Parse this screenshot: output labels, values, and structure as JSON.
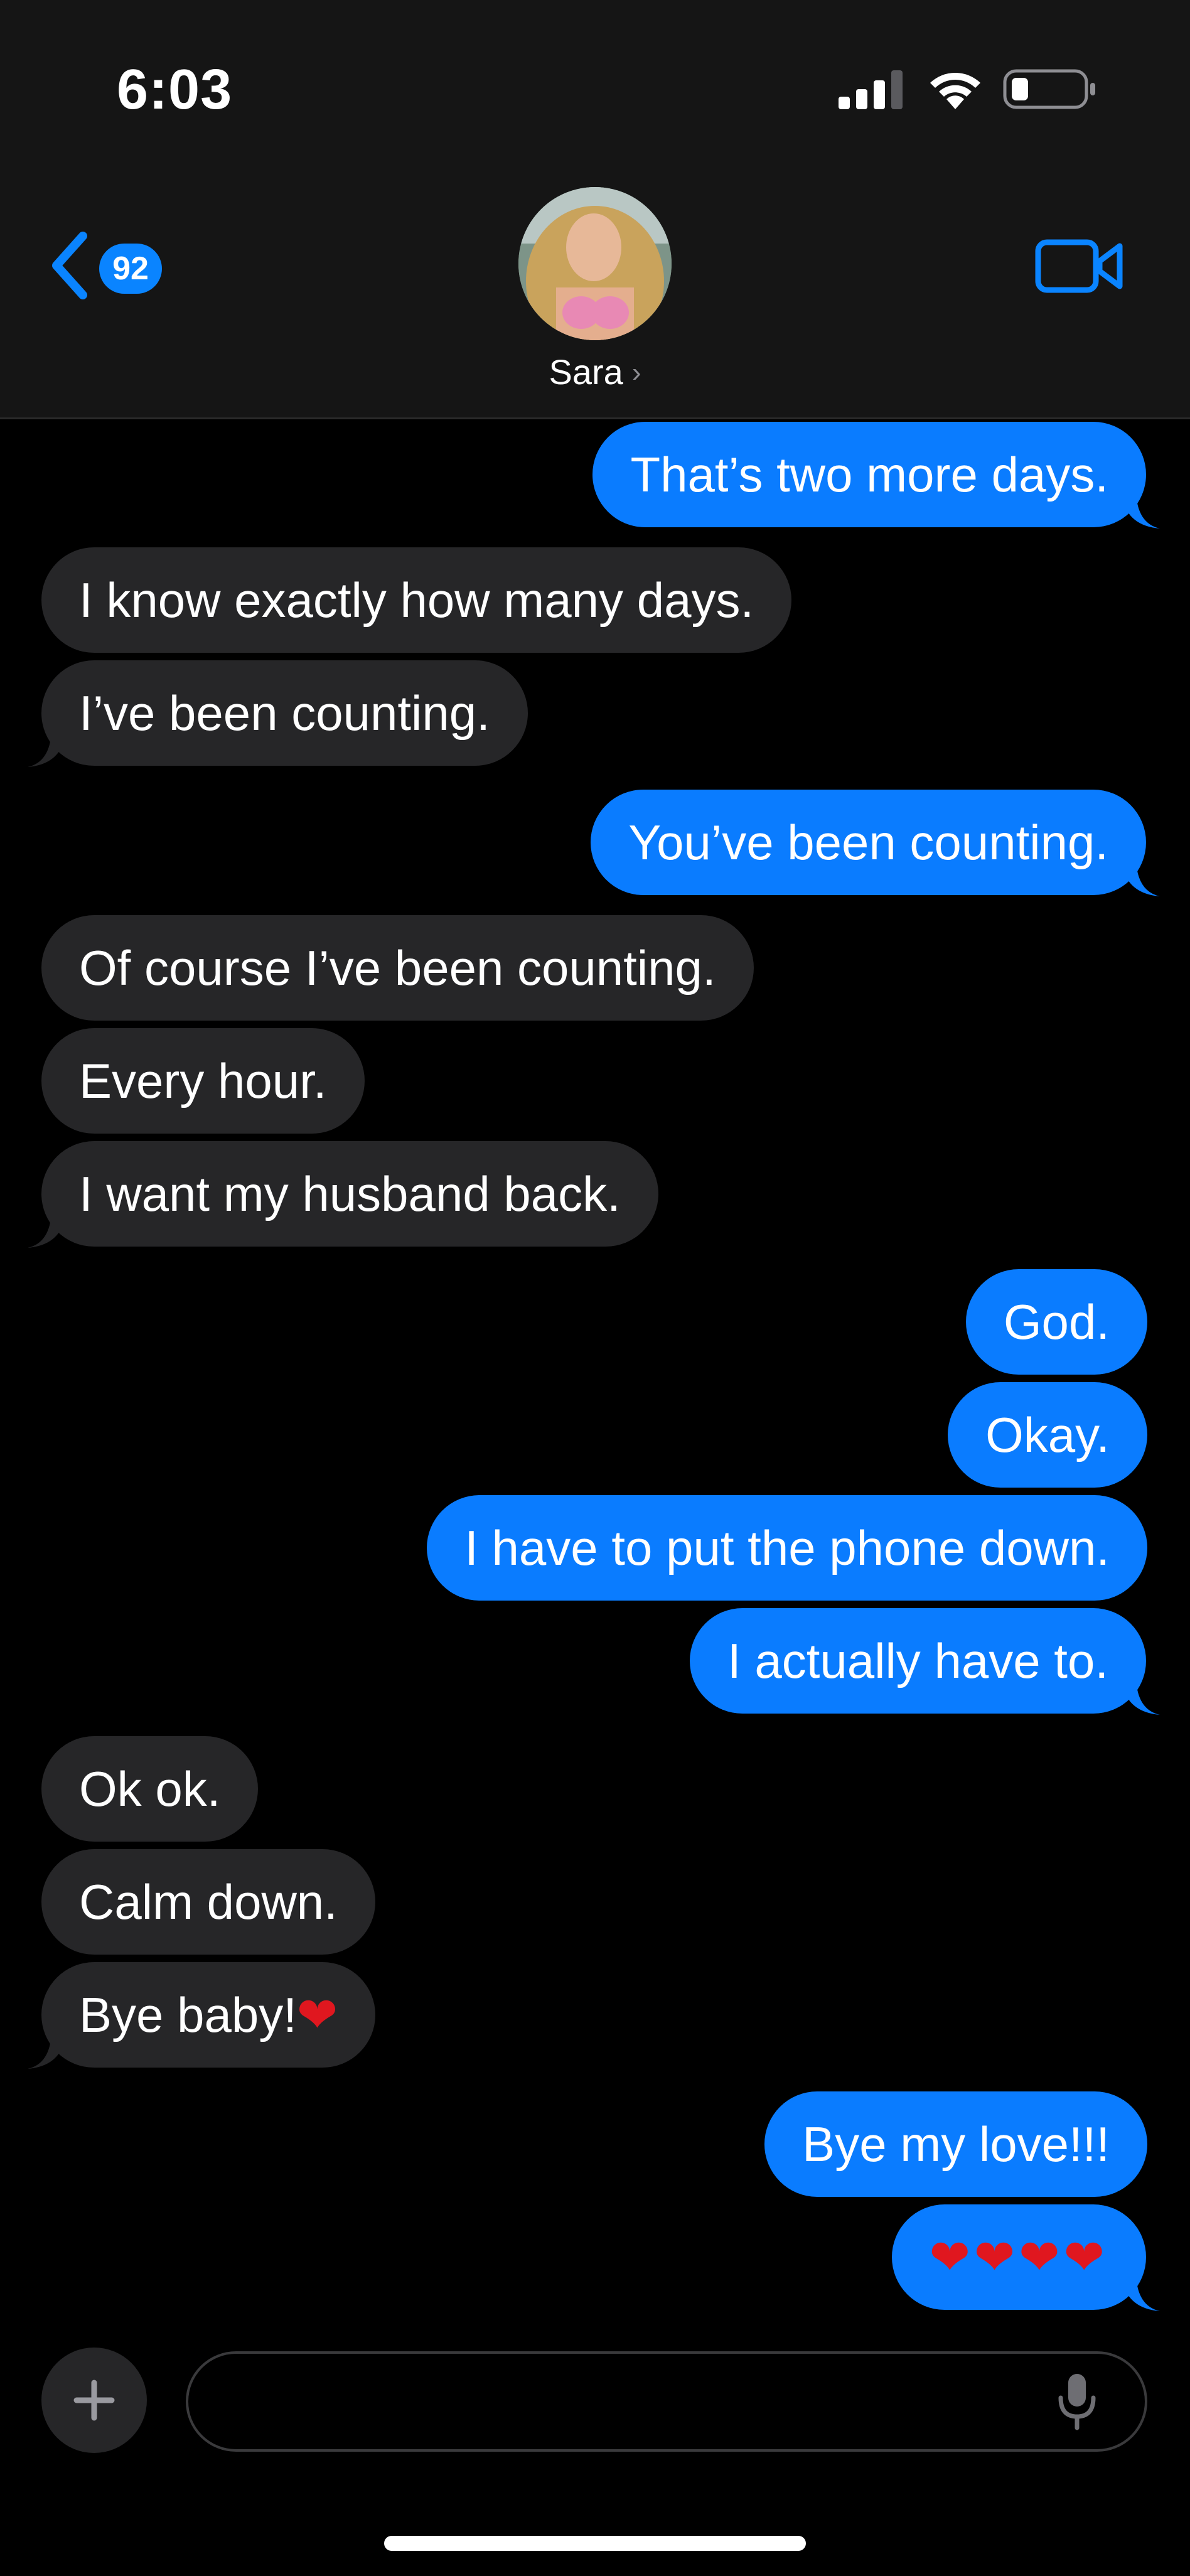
{
  "status_bar": {
    "time": "6:03",
    "signal_icon": "cellular-signal-icon",
    "wifi_icon": "wifi-icon",
    "battery_icon": "battery-icon"
  },
  "nav": {
    "back_icon": "chevron-left-icon",
    "unread_count": "92",
    "contact_name": "Sara",
    "contact_chevron": "›",
    "video_icon": "video-camera-icon"
  },
  "messages": [
    {
      "from": "me",
      "text": "That’s two more days."
    },
    {
      "from": "them",
      "text": "I know exactly how many days."
    },
    {
      "from": "them",
      "text": "I’ve been counting."
    },
    {
      "from": "me",
      "text": "You’ve been counting."
    },
    {
      "from": "them",
      "text": "Of course I’ve been counting."
    },
    {
      "from": "them",
      "text": "Every hour."
    },
    {
      "from": "them",
      "text": "I want my husband back."
    },
    {
      "from": "me",
      "text": "God."
    },
    {
      "from": "me",
      "text": "Okay."
    },
    {
      "from": "me",
      "text": "I have to put the phone down."
    },
    {
      "from": "me",
      "text": "I actually have to."
    },
    {
      "from": "them",
      "text": "Ok ok."
    },
    {
      "from": "them",
      "text": "Calm down."
    },
    {
      "from": "them",
      "text": "Bye baby!",
      "emoji": "❤"
    },
    {
      "from": "me",
      "text": "Bye my love!!!"
    },
    {
      "from": "me",
      "text": "",
      "emoji": "❤❤❤❤"
    }
  ],
  "composer": {
    "plus_icon": "plus-icon",
    "input_value": "",
    "input_placeholder": "",
    "mic_icon": "microphone-icon"
  },
  "colors": {
    "outgoing_bubble": "#0a7cff",
    "incoming_bubble": "#262628",
    "accent": "#0a84ff",
    "heart": "#e0171f"
  }
}
